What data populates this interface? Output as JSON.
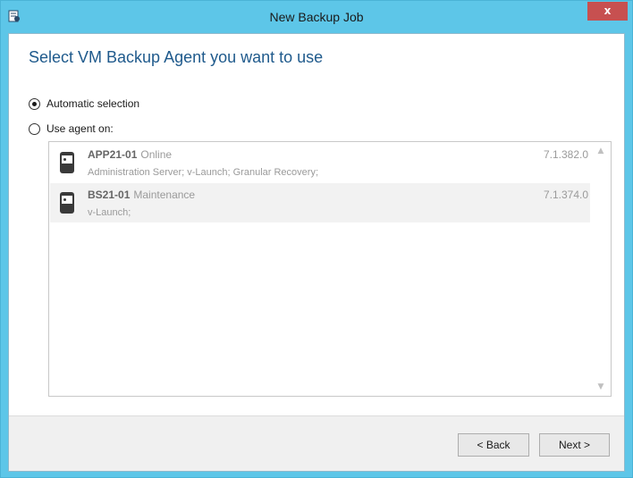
{
  "window": {
    "title": "New Backup Job",
    "close_glyph": "x",
    "app_icon": "backup-job-icon"
  },
  "page": {
    "heading": "Select VM Backup Agent you want to use"
  },
  "options": {
    "automatic": {
      "label": "Automatic selection",
      "checked": true
    },
    "use_agent": {
      "label": "Use agent on:",
      "checked": false
    }
  },
  "agents": [
    {
      "name": "APP21-01",
      "status": "Online",
      "roles": "Administration Server; v-Launch; Granular Recovery;",
      "version": "7.1.382.0",
      "icon": "server-icon"
    },
    {
      "name": "BS21-01",
      "status": "Maintenance",
      "roles": "v-Launch;",
      "version": "7.1.374.0",
      "icon": "server-icon"
    }
  ],
  "footer": {
    "back_label": "< Back",
    "next_label": "Next >"
  }
}
